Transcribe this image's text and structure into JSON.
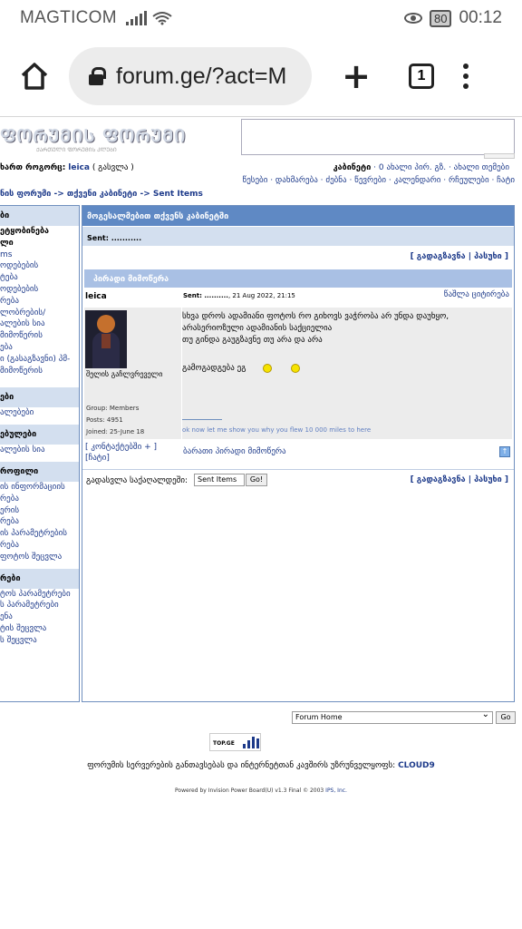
{
  "status_bar": {
    "carrier": "MAGTICOM",
    "battery": "80",
    "time": "00:12"
  },
  "browser": {
    "url": "forum.ge/?act=M",
    "tab_count": "1"
  },
  "forum": {
    "logo_title": "ᲤᲝᲠᲣᲛᲘᲡ ᲤᲝᲠᲣᲛᲘ",
    "logo_subtitle": "ᲥᲐᲠᲗᲣᲚᲘ ᲤᲝᲠᲣᲛᲘᲡ ᲙᲚᲣᲑᲘ",
    "user_line_prefix": "ხართ როგორც:",
    "username": "leica",
    "logout": "( გასვლა )",
    "top_links": {
      "cabinet": "კაბინეტი",
      "new_pm": "· 0 ახალი პირ. გზ. · ახალი თემები"
    },
    "nav_links": "წესები · დახმარება · ძებნა · წევრები · კალენდარი · რჩეულები · ჩატი",
    "breadcrumb": "ნის ფორუმი -> თქვენი კაბინეტი -> Sent Items"
  },
  "sidebar": {
    "sections": [
      {
        "head": "ბი",
        "items": [
          "ეტყობინება",
          "ლი",
          "ms",
          "ოდებების",
          "ტება",
          "ოდებების",
          "რება",
          "ლობრების/",
          "ალების სია",
          "მიმოწერის",
          "ება",
          "ი (გასაგზავნი) პმ-",
          "",
          "მიმოწერის"
        ]
      },
      {
        "head": "ები",
        "items": [
          "",
          "ალებები"
        ]
      },
      {
        "head": "ებულები",
        "items": [
          "",
          "ალების სია"
        ]
      },
      {
        "head": "როფილი",
        "items": [
          "ის ინფორმაციის",
          "რება",
          "ერის",
          "რება",
          "ის პარამეტრების",
          "რება",
          "ფოტოს შეცვლა"
        ]
      },
      {
        "head": "რები",
        "items": [
          "ტოს პარამეტრები",
          "ს პარამეტრები",
          "ენა",
          "ტის შეცვლა",
          "ს შეცვლა"
        ]
      }
    ]
  },
  "main": {
    "title": "მოგესალმებით თქვენს კაბინეტში",
    "sent_label": "Sent: ...........",
    "actions": "[ გადაგზავნა | პასუხი ]",
    "section_title": "პირადი მიმოწერა",
    "post": {
      "author": "leica",
      "date_label": "Sent: ..........",
      "date": ", 21 Aug 2022, 21:15",
      "tools": "წაშლა  ციტირება",
      "signature_title": "შელის გაჩლვრეველი",
      "group": "Group: Members",
      "posts": "Posts: 4951",
      "joined": "Joined: 25-June 18",
      "body_lines": [
        "სხვა დროს ადამიანი ფოტოს რო გიხოვს ვაჭრობა არ უნდა დაუხყო,",
        "არასერიოზული ადამიანის საქციელია",
        "თუ გინდა გაუგზავნე თუ არა და არა"
      ],
      "body_last": "გამოგადგება ეგ",
      "sig_link": "ok now let me show you why you flew 10 000 miles to here"
    },
    "foot_contacts": "[ კონტაქტებში + ]",
    "foot_chat": "[ჩატი]",
    "foot_blacklist": "ბარათი პირადი მიმოწერა",
    "move_label": "გადასვლა საქაღალდეში:",
    "move_select": "Sent Items",
    "go_label": "Go!",
    "bottom_actions": "[ გადაგზავნა | პასუხი ]"
  },
  "footer": {
    "jump_select": "Forum Home",
    "jump_go": "Go",
    "counter_text": "TOP.GE",
    "sponsor_text": "ფორუმის სერვერების განთავსებას და ინტერნეტთან კავშირს უზრუნველყოფს:",
    "sponsor_name": "CLOUD9",
    "powered_text": "Powered by Invision Power Board(U) v1.3 Final © 2003 ",
    "powered_link": "IPS, Inc."
  }
}
